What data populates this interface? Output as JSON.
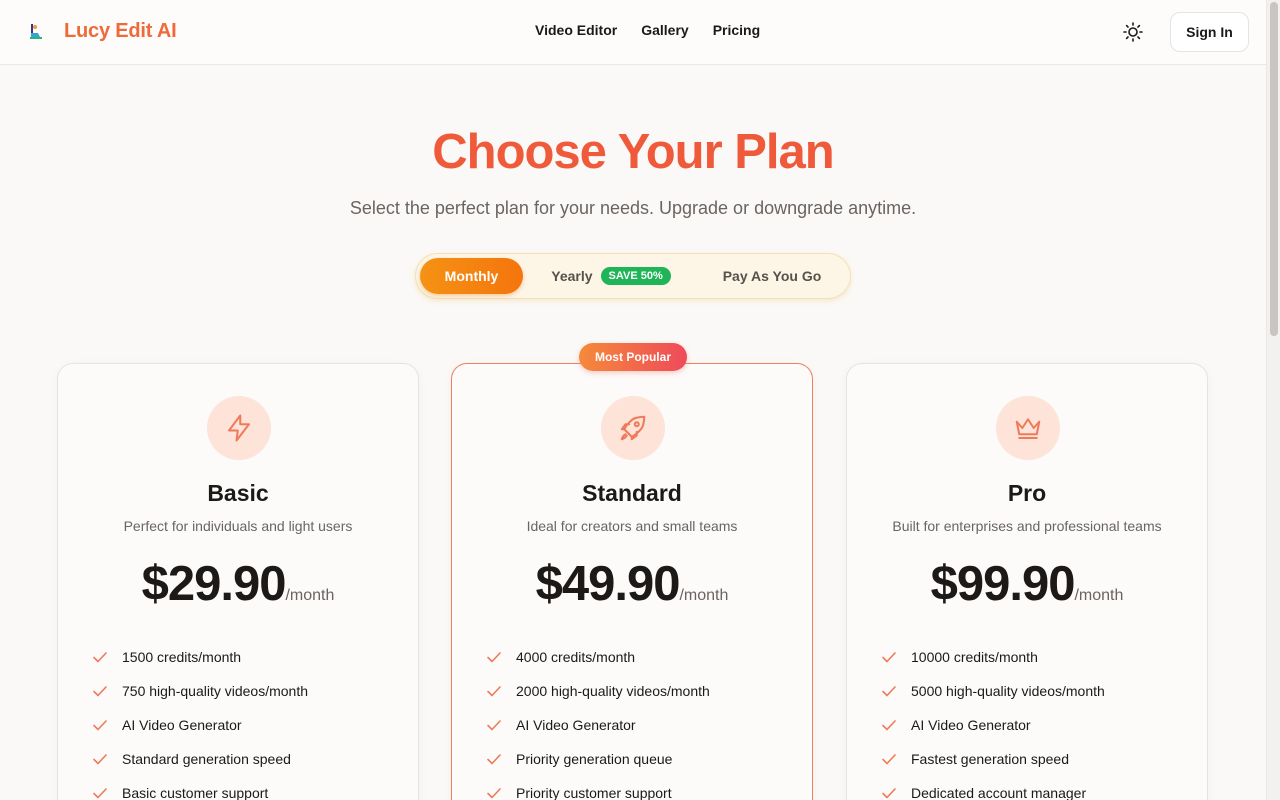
{
  "header": {
    "brand": "Lucy Edit AI",
    "nav": [
      "Video Editor",
      "Gallery",
      "Pricing"
    ],
    "signin_label": "Sign In"
  },
  "hero": {
    "title": "Choose Your Plan",
    "subtitle": "Select the perfect plan for your needs. Upgrade or downgrade anytime."
  },
  "billing": {
    "monthly": "Monthly",
    "yearly": "Yearly",
    "save_badge": "SAVE 50%",
    "payg": "Pay As You Go",
    "selected": "Monthly"
  },
  "plans": [
    {
      "name": "Basic",
      "icon": "lightning-icon",
      "desc": "Perfect for individuals and light users",
      "price": "$29.90",
      "unit": "/month",
      "features": [
        "1500 credits/month",
        "750 high-quality videos/month",
        "AI Video Generator",
        "Standard generation speed",
        "Basic customer support"
      ]
    },
    {
      "name": "Standard",
      "icon": "rocket-icon",
      "badge": "Most Popular",
      "desc": "Ideal for creators and small teams",
      "price": "$49.90",
      "unit": "/month",
      "features": [
        "4000 credits/month",
        "2000 high-quality videos/month",
        "AI Video Generator",
        "Priority generation queue",
        "Priority customer support"
      ]
    },
    {
      "name": "Pro",
      "icon": "crown-icon",
      "desc": "Built for enterprises and professional teams",
      "price": "$99.90",
      "unit": "/month",
      "features": [
        "10000 credits/month",
        "5000 high-quality videos/month",
        "AI Video Generator",
        "Fastest generation speed",
        "Dedicated account manager"
      ]
    }
  ],
  "colors": {
    "brand": "#ef6a3a",
    "title": "#ef5a3a",
    "toggle_active": "#f4750d",
    "save_badge": "#1fb457",
    "check": "#ef7a5a"
  }
}
